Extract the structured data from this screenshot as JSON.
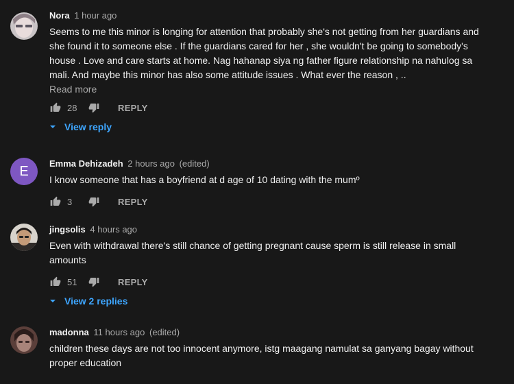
{
  "comments": [
    {
      "author": "Nora",
      "time": "1 hour ago",
      "edited": "",
      "avatar_letter": "",
      "text": "Seems to me this minor is longing for attention that probably she's not getting from her guardians and she found it to someone else . If the guardians cared for her , she wouldn't be going to somebody's house . Love and care starts at home. Nag hahanap siya ng father figure relationship na nahulog sa mali. And maybe this minor has also some attitude issues . What ever the reason , ..",
      "read_more": "Read more",
      "likes": "28",
      "reply_label": "REPLY",
      "view_replies": "View reply"
    },
    {
      "author": "Emma Dehizadeh",
      "time": "2 hours ago",
      "edited": "(edited)",
      "avatar_letter": "E",
      "text": "I know someone that has a boyfriend at d age of 10 dating with the mumº",
      "read_more": "",
      "likes": "3",
      "reply_label": "REPLY",
      "view_replies": ""
    },
    {
      "author": "jingsolis",
      "time": "4 hours ago",
      "edited": "",
      "avatar_letter": "",
      "text": "Even with withdrawal there's still chance of getting pregnant cause sperm is still release in small amounts",
      "read_more": "",
      "likes": "51",
      "reply_label": "REPLY",
      "view_replies": "View 2 replies"
    },
    {
      "author": "madonna",
      "time": "11 hours ago",
      "edited": "(edited)",
      "avatar_letter": "",
      "text": "children these days are not too innocent anymore, istg maagang namulat sa ganyang bagay without proper education",
      "read_more": "",
      "likes": "",
      "reply_label": "",
      "view_replies": ""
    }
  ],
  "colors": {
    "background": "#181818",
    "link_blue": "#3ea6ff",
    "muted": "#aaaaaa",
    "avatar_purple": "#7e57c2"
  },
  "icons": {
    "like": "thumb-up-icon",
    "dislike": "thumb-down-icon",
    "expand": "caret-down-icon"
  }
}
